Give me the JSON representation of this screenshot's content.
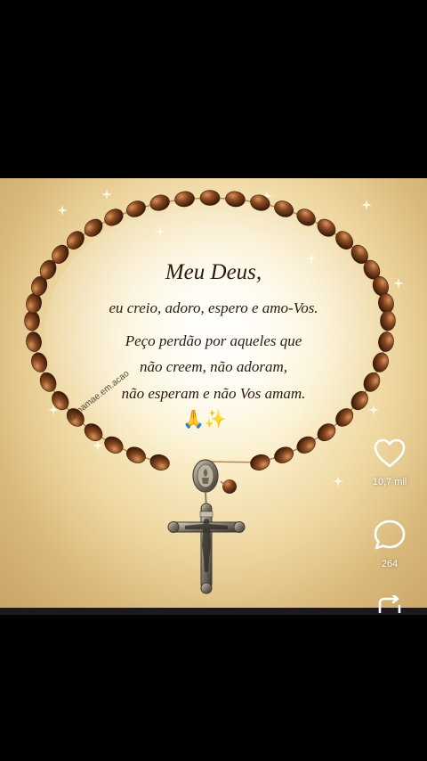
{
  "post": {
    "watermark": "@mamae.em.acao",
    "title": "Meu Deus,",
    "lines": [
      "eu creio, adoro, espero e amo-Vos.",
      "Peço perdão por aqueles que",
      "não creem, não adoram,",
      "não esperam e não Vos amam."
    ],
    "emojis": "🙏✨"
  },
  "actions": {
    "like": {
      "icon": "heart-outline-icon",
      "count": "10,7 mil"
    },
    "comment": {
      "icon": "comment-bubble-icon",
      "count": "264"
    },
    "share": {
      "icon": "repost-icon"
    }
  },
  "colors": {
    "background": "#000000",
    "bead": "#8a4a22",
    "parchment": "#f4e3b8",
    "text": "#2a1a0c"
  }
}
